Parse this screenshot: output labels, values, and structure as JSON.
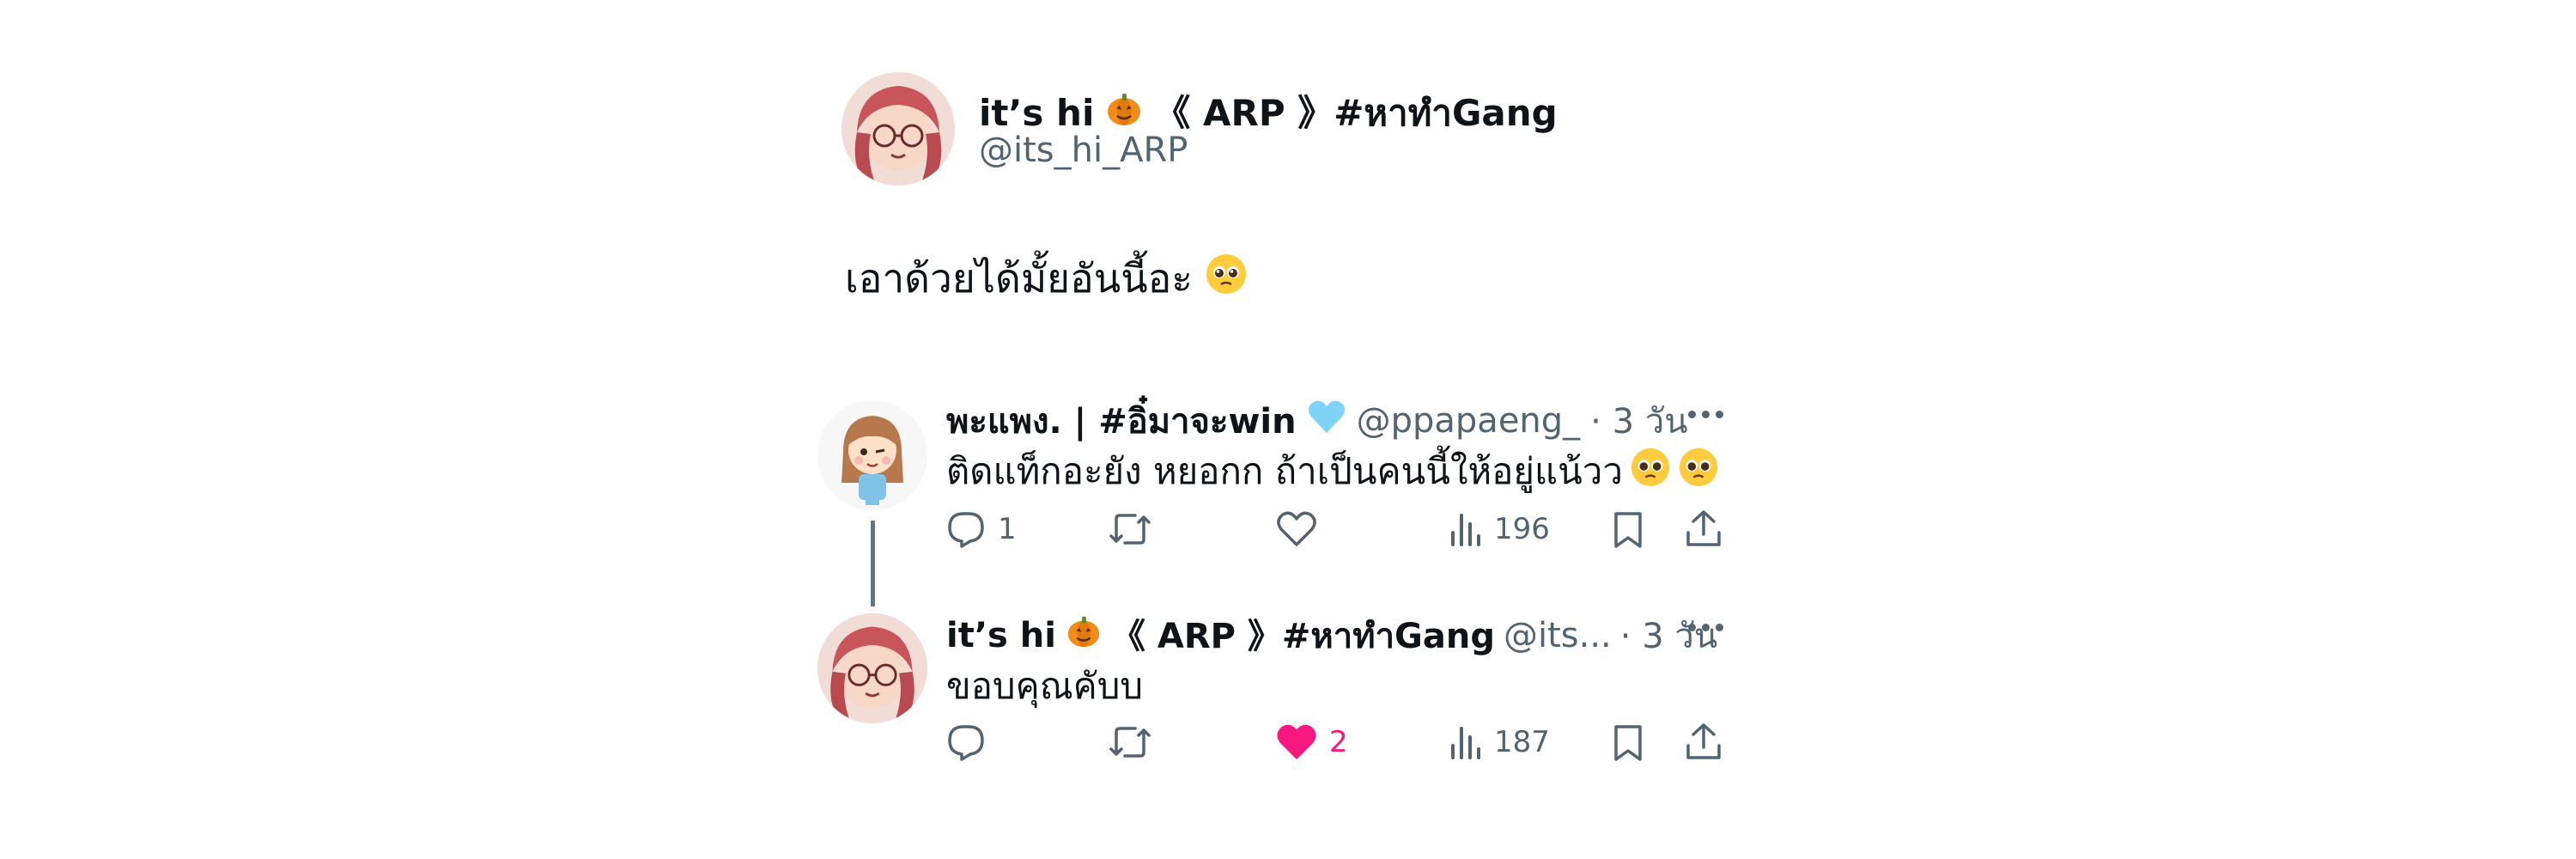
{
  "main_tweet": {
    "display_name": "it’s hi",
    "name_suffix": "《 ARP 》#หาทำGang",
    "handle": "@its_hi_ARP",
    "text": "เอาด้วยได้มั้ยอันนี้อะ"
  },
  "reply_1": {
    "display_name": "พะแพง. | #อิ๋มาจะwin",
    "handle": "@ppapaeng_",
    "time": "· 3 วัน",
    "text": "ติดแท็กอะยัง หยอกก ถ้าเป็นคนนี้ให้อยู่แน้วว",
    "stats": {
      "replies": "1",
      "retweets": "",
      "likes": "",
      "views": "196"
    }
  },
  "reply_2": {
    "display_name": "it’s hi",
    "name_suffix": "《 ARP 》#หาทำGang",
    "handle": "@its...",
    "time": "· 3 วัน",
    "text": "ขอบคุณคับบ",
    "stats": {
      "replies": "",
      "retweets": "",
      "likes": "2",
      "views": "187"
    }
  },
  "icons": [
    "reply-icon",
    "retweet-icon",
    "like-icon",
    "views-icon",
    "bookmark-icon",
    "share-icon",
    "more-icon",
    "pumpkin-icon",
    "pleading-face-icon",
    "blue-heart-icon"
  ],
  "colors": {
    "text": "#0f1419",
    "muted": "#536471",
    "like": "#f91880",
    "blue_heart": "#7fd3f7"
  }
}
